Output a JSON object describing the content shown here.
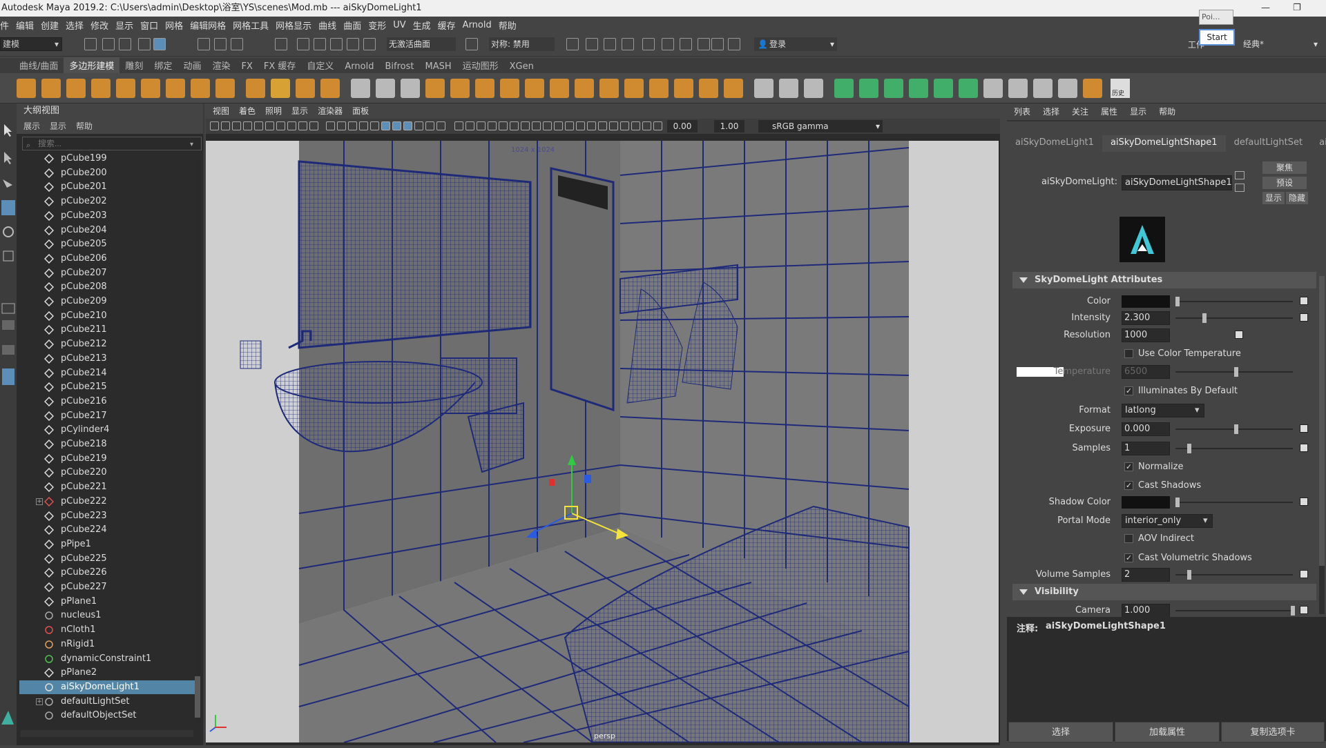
{
  "titlebar": {
    "title": "Autodesk Maya 2019.2: C:\\Users\\admin\\Desktop\\浴室\\YS\\scenes\\Mod.mb  ---  aiSkyDomeLight1",
    "popup_label": "Poi...",
    "start_button": "Start"
  },
  "menubar": [
    "件",
    "编辑",
    "创建",
    "选择",
    "修改",
    "显示",
    "窗口",
    "网格",
    "编辑网格",
    "网格工具",
    "网格显示",
    "曲线",
    "曲面",
    "变形",
    "UV",
    "生成",
    "缓存",
    "Arnold",
    "帮助"
  ],
  "workspace": {
    "label": "工作",
    "value": "经典*"
  },
  "status": {
    "mode_menu": "建模",
    "live_surface": "无激活曲面",
    "symmetry": "对称: 禁用",
    "login": "登录"
  },
  "shelf_tabs": [
    "曲线/曲面",
    "多边形建模",
    "雕刻",
    "绑定",
    "动画",
    "渲染",
    "FX",
    "FX 缓存",
    "自定义",
    "Arnold",
    "Bifrost",
    "MASH",
    "运动图形",
    "XGen"
  ],
  "shelf_active": "多边形建模",
  "shelf_history_label": "历史",
  "outliner": {
    "title": "大纲视图",
    "menus": [
      "展示",
      "显示",
      "帮助"
    ],
    "search_placeholder": "搜索...",
    "items": [
      {
        "label": "pCube199",
        "type": "mesh"
      },
      {
        "label": "pCube200",
        "type": "mesh"
      },
      {
        "label": "pCube201",
        "type": "mesh"
      },
      {
        "label": "pCube202",
        "type": "mesh"
      },
      {
        "label": "pCube203",
        "type": "mesh"
      },
      {
        "label": "pCube204",
        "type": "mesh"
      },
      {
        "label": "pCube205",
        "type": "mesh"
      },
      {
        "label": "pCube206",
        "type": "mesh"
      },
      {
        "label": "pCube207",
        "type": "mesh"
      },
      {
        "label": "pCube208",
        "type": "mesh"
      },
      {
        "label": "pCube209",
        "type": "mesh"
      },
      {
        "label": "pCube210",
        "type": "mesh"
      },
      {
        "label": "pCube211",
        "type": "mesh"
      },
      {
        "label": "pCube212",
        "type": "mesh"
      },
      {
        "label": "pCube213",
        "type": "mesh"
      },
      {
        "label": "pCube214",
        "type": "mesh"
      },
      {
        "label": "pCube215",
        "type": "mesh"
      },
      {
        "label": "pCube216",
        "type": "mesh"
      },
      {
        "label": "pCube217",
        "type": "mesh"
      },
      {
        "label": "pCylinder4",
        "type": "mesh"
      },
      {
        "label": "pCube218",
        "type": "mesh"
      },
      {
        "label": "pCube219",
        "type": "mesh"
      },
      {
        "label": "pCube220",
        "type": "mesh"
      },
      {
        "label": "pCube221",
        "type": "mesh"
      },
      {
        "label": "pCube222",
        "type": "group"
      },
      {
        "label": "pCube223",
        "type": "mesh"
      },
      {
        "label": "pCube224",
        "type": "mesh"
      },
      {
        "label": "pPipe1",
        "type": "mesh"
      },
      {
        "label": "pCube225",
        "type": "mesh"
      },
      {
        "label": "pCube226",
        "type": "mesh"
      },
      {
        "label": "pCube227",
        "type": "mesh"
      },
      {
        "label": "pPlane1",
        "type": "mesh"
      },
      {
        "label": "nucleus1",
        "type": "nucleus"
      },
      {
        "label": "nCloth1",
        "type": "ncloth"
      },
      {
        "label": "nRigid1",
        "type": "nrigid"
      },
      {
        "label": "dynamicConstraint1",
        "type": "constraint"
      },
      {
        "label": "pPlane2",
        "type": "mesh"
      },
      {
        "label": "aiSkyDomeLight1",
        "type": "light",
        "selected": true
      },
      {
        "label": "defaultLightSet",
        "type": "set"
      },
      {
        "label": "defaultObjectSet",
        "type": "set"
      }
    ]
  },
  "viewport": {
    "menus": [
      "视图",
      "着色",
      "照明",
      "显示",
      "渲染器",
      "面板"
    ],
    "field_a": "0.00",
    "field_b": "1.00",
    "color_space": "sRGB gamma",
    "resolution_gate": "1024 x 1024",
    "camera": "persp"
  },
  "attr_editor": {
    "menus": [
      "列表",
      "选择",
      "关注",
      "属性",
      "显示",
      "帮助"
    ],
    "tabs": [
      "aiSkyDomeLight1",
      "aiSkyDomeLightShape1",
      "defaultLightSet",
      "ai"
    ],
    "active_tab": "aiSkyDomeLightShape1",
    "node_label": "aiSkyDomeLight:",
    "node_value": "aiSkyDomeLightShape1",
    "side_buttons": [
      "聚焦",
      "预设",
      "显示",
      "隐藏"
    ],
    "section_main": "SkyDomeLight Attributes",
    "section_visibility": "Visibility",
    "attrs": {
      "color_label": "Color",
      "intensity_label": "Intensity",
      "intensity": "2.300",
      "resolution_label": "Resolution",
      "resolution": "1000",
      "use_color_temp": "Use Color Temperature",
      "temperature_label": "Temperature",
      "temperature": "6500",
      "illuminates": "Illuminates By Default",
      "format_label": "Format",
      "format": "latlong",
      "exposure_label": "Exposure",
      "exposure": "0.000",
      "samples_label": "Samples",
      "samples": "1",
      "normalize": "Normalize",
      "cast_shadows": "Cast Shadows",
      "shadow_color_label": "Shadow Color",
      "portal_mode_label": "Portal Mode",
      "portal_mode": "interior_only",
      "aov_indirect": "AOV Indirect",
      "cast_vol": "Cast Volumetric Shadows",
      "vol_samples_label": "Volume Samples",
      "vol_samples": "2",
      "camera_label": "Camera",
      "camera": "1.000"
    },
    "checks": {
      "use_color_temp": false,
      "illuminates": true,
      "normalize": true,
      "cast_shadows": true,
      "aov_indirect": false,
      "cast_vol": true
    },
    "slider_levels": {
      "intensity": 0.23,
      "exposure": 0.5,
      "samples": 0.1,
      "temperature": 0.5,
      "vol_samples": 0.1,
      "camera": 0.98
    },
    "notes_label": "注释:",
    "notes_value": "aiSkyDomeLightShape1",
    "bottom_buttons": [
      "选择",
      "加载属性",
      "复制选项卡"
    ]
  },
  "colors": {
    "selection": "#5285a6",
    "wire": "#1e2a78",
    "surface": "#707070"
  }
}
